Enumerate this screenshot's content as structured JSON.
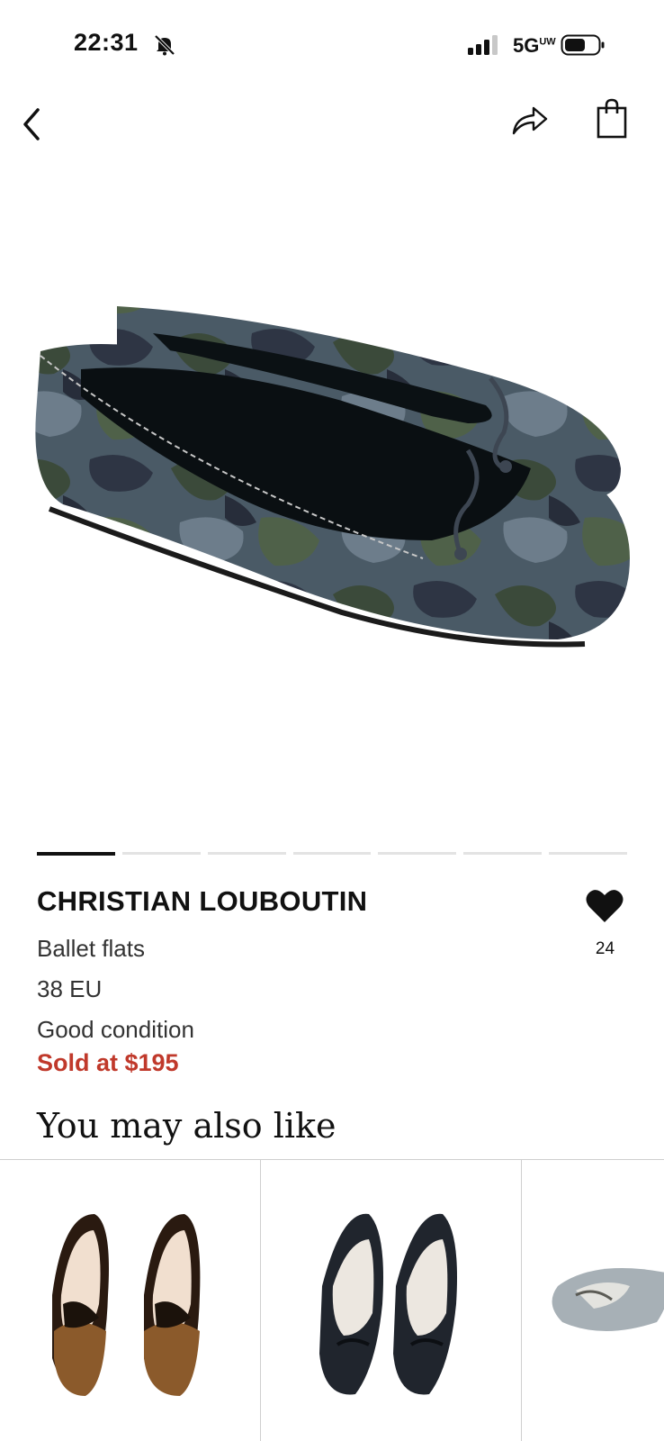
{
  "status_bar": {
    "time": "22:31",
    "network": "5G",
    "network_sub": "UW"
  },
  "icons": {
    "back": "chevron-left-icon",
    "share": "share-arrow-icon",
    "bag": "shopping-bag-icon",
    "like": "heart-icon",
    "mute": "bell-slash-icon"
  },
  "product": {
    "brand": "CHRISTIAN LOUBOUTIN",
    "type": "Ballet flats",
    "size": "38 EU",
    "condition": "Good condition",
    "sold_text": "Sold at $195",
    "likes": "24",
    "image_count": 7,
    "active_image": 1
  },
  "recommendations": {
    "title": "You may also like"
  },
  "colors": {
    "accent_red": "#c0392b",
    "text": "#111111"
  }
}
